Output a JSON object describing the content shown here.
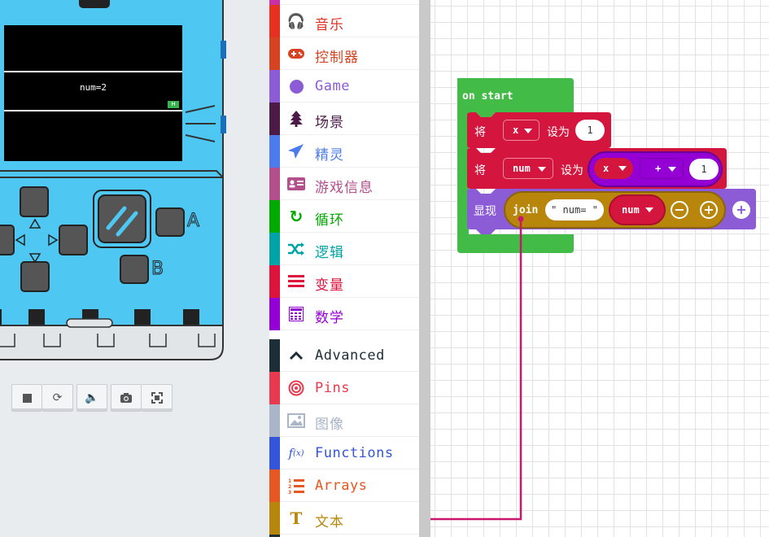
{
  "simulator": {
    "screen_text": "num=2",
    "button_a_label": "A",
    "button_b_label": "B",
    "toolbar": [
      "stop",
      "restart",
      "mute",
      "screenshot",
      "fullscreen"
    ]
  },
  "toolbox": {
    "categories": [
      {
        "label": "音乐",
        "icon": "headphones-icon",
        "color": "#e63022"
      },
      {
        "label": "控制器",
        "icon": "gamepad-icon",
        "color": "#d54322"
      },
      {
        "label": "Game",
        "icon": "circle-icon",
        "color": "#8b5cd6"
      },
      {
        "label": "场景",
        "icon": "tree-icon",
        "color": "#4b1a47"
      },
      {
        "label": "精灵",
        "icon": "paper-plane-icon",
        "color": "#4b7bec"
      },
      {
        "label": "游戏信息",
        "icon": "id-card-icon",
        "color": "#b24f8c"
      },
      {
        "label": "循环",
        "icon": "refresh-icon",
        "color": "#00aa00"
      },
      {
        "label": "逻辑",
        "icon": "shuffle-icon",
        "color": "#00a4a6"
      },
      {
        "label": "变量",
        "icon": "list-icon",
        "color": "#dc143c"
      },
      {
        "label": "数学",
        "icon": "calculator-icon",
        "color": "#9400d3"
      },
      {
        "label": "Advanced",
        "icon": "chevron-up-icon",
        "color": "#1c2f36"
      },
      {
        "label": "Pins",
        "icon": "target-icon",
        "color": "#e83a4e"
      },
      {
        "label": "图像",
        "icon": "image-icon",
        "color": "#aab5c8"
      },
      {
        "label": "Functions",
        "icon": "function-icon",
        "color": "#3455db"
      },
      {
        "label": "Arrays",
        "icon": "numbered-list-icon",
        "color": "#e65722"
      },
      {
        "label": "文本",
        "icon": "text-icon",
        "color": "#b8860b"
      }
    ]
  },
  "workspace": {
    "on_start": "on start",
    "set1": {
      "keyword": "将",
      "var": "x",
      "to": "设为",
      "value": "1"
    },
    "set2": {
      "keyword": "将",
      "var": "num",
      "to": "设为",
      "left": "x",
      "op": "+",
      "right": "1"
    },
    "show": {
      "keyword": "显现",
      "func": "join",
      "arg1": "\" num= \"",
      "arg2": "num"
    }
  }
}
